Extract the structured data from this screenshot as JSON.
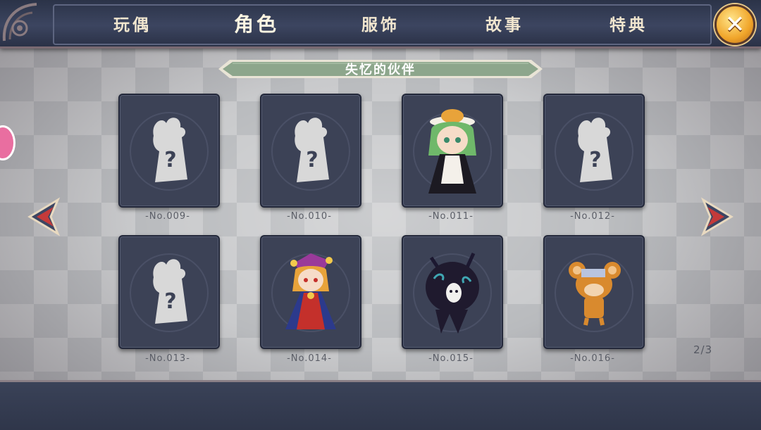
{
  "tabs": [
    {
      "label": "玩偶",
      "active": false
    },
    {
      "label": "角色",
      "active": true
    },
    {
      "label": "服饰",
      "active": false
    },
    {
      "label": "故事",
      "active": false
    },
    {
      "label": "特典",
      "active": false
    }
  ],
  "close_icon": "close-x-icon",
  "section_title": "失忆的伙伴",
  "cards": [
    {
      "number": "-No.009-",
      "unlocked": false
    },
    {
      "number": "-No.010-",
      "unlocked": false
    },
    {
      "number": "-No.011-",
      "unlocked": true,
      "character": "green-haired-maid-icon"
    },
    {
      "number": "-No.012-",
      "unlocked": false
    },
    {
      "number": "-No.013-",
      "unlocked": false
    },
    {
      "number": "-No.014-",
      "unlocked": true,
      "character": "jester-icon"
    },
    {
      "number": "-No.015-",
      "unlocked": true,
      "character": "shadow-creature-icon"
    },
    {
      "number": "-No.016-",
      "unlocked": true,
      "character": "mouse-doll-icon"
    }
  ],
  "pagination": "2/3",
  "colors": {
    "accent": "#f0a52a",
    "banner": "#8da68c",
    "card": "#3c4256"
  }
}
